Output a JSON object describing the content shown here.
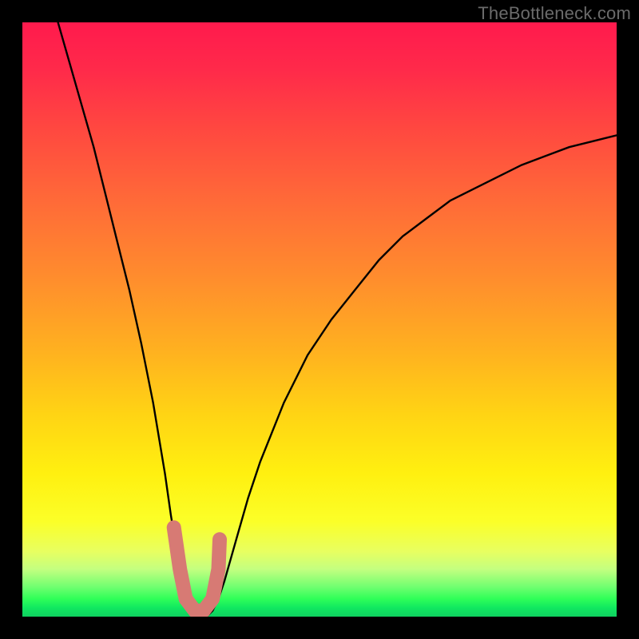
{
  "watermark": "TheBottleneck.com",
  "chart_data": {
    "type": "line",
    "title": "",
    "xlabel": "",
    "ylabel": "",
    "xlim": [
      0,
      100
    ],
    "ylim": [
      0,
      100
    ],
    "series": [
      {
        "name": "bottleneck-curve",
        "x": [
          6,
          8,
          10,
          12,
          14,
          16,
          18,
          20,
          22,
          24,
          25,
          26,
          27,
          28,
          29,
          30,
          31,
          32,
          33,
          34,
          36,
          38,
          40,
          44,
          48,
          52,
          56,
          60,
          64,
          68,
          72,
          76,
          80,
          84,
          88,
          92,
          96,
          100
        ],
        "y": [
          100,
          93,
          86,
          79,
          71,
          63,
          55,
          46,
          36,
          24,
          17,
          11,
          6,
          3,
          1,
          0,
          0,
          1,
          3,
          6,
          13,
          20,
          26,
          36,
          44,
          50,
          55,
          60,
          64,
          67,
          70,
          72,
          74,
          76,
          77.5,
          79,
          80,
          81
        ]
      }
    ],
    "marker": {
      "name": "highlight-region",
      "points": [
        {
          "x": 25.5,
          "y": 15
        },
        {
          "x": 26.5,
          "y": 8
        },
        {
          "x": 27.5,
          "y": 3
        },
        {
          "x": 29,
          "y": 1
        },
        {
          "x": 30.5,
          "y": 1
        },
        {
          "x": 32,
          "y": 3
        },
        {
          "x": 33,
          "y": 8
        },
        {
          "x": 33.2,
          "y": 13
        }
      ]
    },
    "background_gradient": {
      "top_color": "#ff1a4d",
      "bottom_color": "#0fd060",
      "stops": [
        "red",
        "orange",
        "yellow",
        "green"
      ]
    }
  }
}
